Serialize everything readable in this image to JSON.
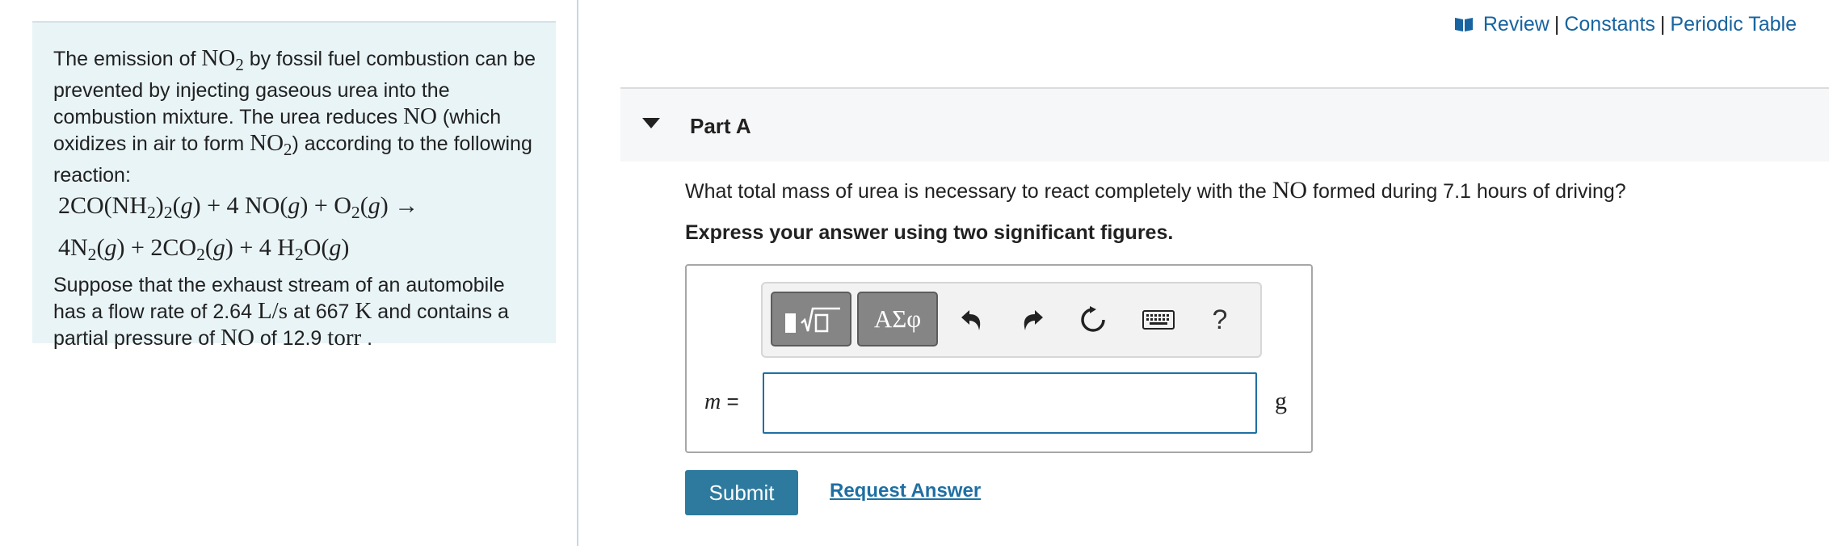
{
  "links": {
    "review": "Review",
    "separator": "|",
    "constants": "Constants",
    "periodic_table": "Periodic Table"
  },
  "problem": {
    "intro_1": "The emission of ",
    "no2": "NO",
    "two": "2",
    "intro_2": " by fossil fuel combustion can be prevented by injecting gaseous urea into the combustion mixture. The urea reduces ",
    "no": "NO",
    "intro_3": " (which oxidizes in air to form ",
    "intro_4": ") according to the following reaction:",
    "reaction_line_1": {
      "t1": "2CO(NH",
      "s1": "2",
      "t2": ")",
      "s2": "2",
      "t3": "(",
      "g": "g",
      "t4": ") + 4 NO(",
      "t5": ") + O",
      "s3": "2",
      "t6": "(",
      "t7": ") →"
    },
    "reaction_line_2": {
      "t1": "4N",
      "s1": "2",
      "t2": "(",
      "g": "g",
      "t3": ") + 2CO",
      "s2": "2",
      "t4": "(",
      "t5": ") + 4 H",
      "s3": "2",
      "t6": "O(",
      "t7": ")"
    },
    "exhaust_1": "Suppose that the exhaust stream of an automobile has a flow rate of 2.64 ",
    "flow_unit": "L/s",
    "exhaust_2": " at 667 ",
    "temp_unit": "K",
    "exhaust_3": " and contains a partial pressure of ",
    "exhaust_4": " of 12.9 ",
    "pressure_unit": "torr",
    "exhaust_5": " ."
  },
  "part": {
    "title": "Part A"
  },
  "question": {
    "text_1": "What total mass of urea is necessary to react completely with the ",
    "species": "NO",
    "text_2": " formed during 7.1 hours of driving?",
    "instruction": "Express your answer using two significant figures."
  },
  "toolbar": {
    "symbols_label": "ΑΣφ",
    "help_label": "?"
  },
  "answer": {
    "variable": "m",
    "equals": " =",
    "value": "",
    "unit": "g"
  },
  "actions": {
    "submit_label": "Submit",
    "request_answer_label": "Request Answer"
  },
  "colors": {
    "link": "#1764a0",
    "panel_bg": "#e9f4f7",
    "submit_bg": "#2e7a9f",
    "input_border": "#1f6fa3"
  },
  "icons": [
    "book-icon",
    "caret-down-icon",
    "templates-icon",
    "undo-icon",
    "redo-icon",
    "reset-icon",
    "keyboard-icon",
    "help-icon"
  ]
}
